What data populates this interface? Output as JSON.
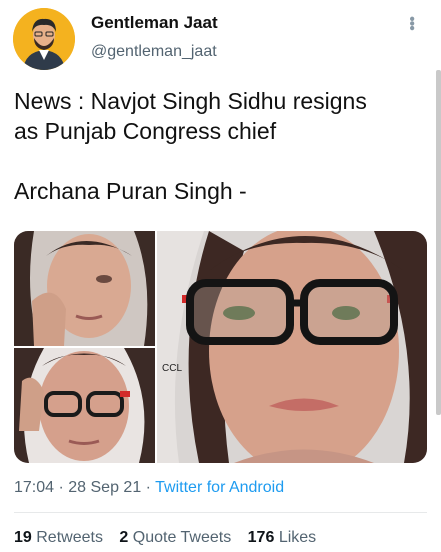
{
  "author": {
    "name": "Gentleman Jaat",
    "handle": "@gentleman_jaat"
  },
  "tweet": {
    "text": "News : Navjot Singh Sidhu resigns\nas Punjab Congress chief\n\nArchana Puran Singh -"
  },
  "media": {
    "watermark": "CCL"
  },
  "meta": {
    "time": "17:04",
    "sep1": " · ",
    "date": "28 Sep 21",
    "sep2": " · ",
    "source": "Twitter for Android"
  },
  "stats": {
    "retweets_count": "19",
    "retweets_label": "Retweets",
    "quotes_count": "2",
    "quotes_label": "Quote Tweets",
    "likes_count": "176",
    "likes_label": "Likes"
  },
  "icons": [
    "more-options-icon"
  ],
  "colors": {
    "link": "#1d9bf0",
    "muted": "#536471",
    "avatar_bg": "#f4b21f"
  }
}
